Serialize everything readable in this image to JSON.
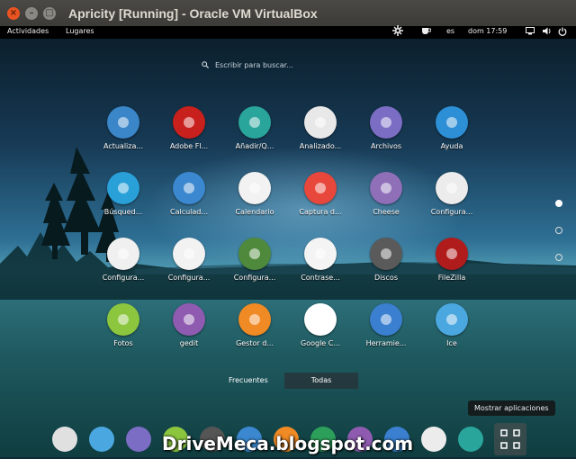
{
  "window": {
    "title": "Apricity [Running] - Oracle VM VirtualBox"
  },
  "topbar": {
    "activities": "Actividades",
    "places": "Lugares",
    "language": "es",
    "clock": "dom 17:59"
  },
  "search": {
    "placeholder": "Escribir para buscar..."
  },
  "apps": [
    {
      "label": "Actualiza...",
      "icon": "update-icon",
      "color": "#3a86c8"
    },
    {
      "label": "Adobe Fl...",
      "icon": "flash-icon",
      "color": "#c8201c"
    },
    {
      "label": "Añadir/Q...",
      "icon": "add-remove-icon",
      "color": "#2aa59b"
    },
    {
      "label": "Analizado...",
      "icon": "disk-usage-icon",
      "color": "#e8e8e8"
    },
    {
      "label": "Archivos",
      "icon": "files-icon",
      "color": "#7b6cc4"
    },
    {
      "label": "Ayuda",
      "icon": "help-icon",
      "color": "#2d8fd6"
    },
    {
      "label": "Búsqued...",
      "icon": "search-icon",
      "color": "#29a0d8"
    },
    {
      "label": "Calculad...",
      "icon": "calculator-icon",
      "color": "#3b88d0"
    },
    {
      "label": "Calendario",
      "icon": "calendar-icon",
      "color": "#f2f2f2"
    },
    {
      "label": "Captura d...",
      "icon": "screenshot-icon",
      "color": "#e8473b"
    },
    {
      "label": "Cheese",
      "icon": "webcam-icon",
      "color": "#8e6fb8"
    },
    {
      "label": "Configura...",
      "icon": "settings-toggle-icon",
      "color": "#ececec"
    },
    {
      "label": "Configura...",
      "icon": "printer-icon",
      "color": "#f0f0f0"
    },
    {
      "label": "Configura...",
      "icon": "firewall-shield-icon",
      "color": "#f2f2f2"
    },
    {
      "label": "Configura...",
      "icon": "software-update-icon",
      "color": "#4f8a3c"
    },
    {
      "label": "Contrase...",
      "icon": "keyring-icon",
      "color": "#f4f4f4"
    },
    {
      "label": "Discos",
      "icon": "disks-icon",
      "color": "#5a5a5a"
    },
    {
      "label": "FileZilla",
      "icon": "filezilla-icon",
      "color": "#b01c1c"
    },
    {
      "label": "Fotos",
      "icon": "photos-icon",
      "color": "#8cc63f"
    },
    {
      "label": "gedit",
      "icon": "text-editor-icon",
      "color": "#8e5bb0"
    },
    {
      "label": "Gestor d...",
      "icon": "archive-manager-icon",
      "color": "#f08a24"
    },
    {
      "label": "Google C...",
      "icon": "chrome-icon",
      "color": "#ffffff"
    },
    {
      "label": "Herramie...",
      "icon": "tools-icon",
      "color": "#3a7fd0"
    },
    {
      "label": "Ice",
      "icon": "cloud-icon",
      "color": "#4aa7e0"
    }
  ],
  "tabs": {
    "frequent": "Frecuentes",
    "all": "Todas"
  },
  "tooltip": "Mostrar aplicaciones",
  "dock": [
    {
      "icon": "chrome-icon",
      "color": "#e0e0e0"
    },
    {
      "icon": "cloud-icon",
      "color": "#4aa7e0"
    },
    {
      "icon": "files-icon",
      "color": "#7b6cc4"
    },
    {
      "icon": "photos-icon",
      "color": "#8cc63f"
    },
    {
      "icon": "calculator-icon",
      "color": "#555555"
    },
    {
      "icon": "terminal-icon",
      "color": "#3b88d0"
    },
    {
      "icon": "archive-manager-icon",
      "color": "#f08a24"
    },
    {
      "icon": "spreadsheet-icon",
      "color": "#2ca05a"
    },
    {
      "icon": "text-editor-icon",
      "color": "#8e5bb0"
    },
    {
      "icon": "tools-icon",
      "color": "#3a7fd0"
    },
    {
      "icon": "settings-toggle-icon",
      "color": "#ececec"
    },
    {
      "icon": "add-remove-icon",
      "color": "#2aa59b"
    }
  ],
  "watermark": "DriveMeca.blogspot.com"
}
